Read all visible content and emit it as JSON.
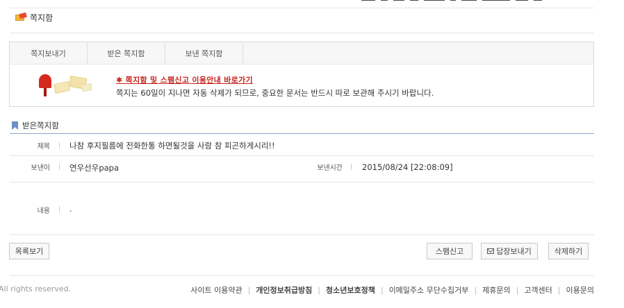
{
  "page": {
    "title": "쪽지함"
  },
  "tabs": [
    {
      "label": "쪽지보내기"
    },
    {
      "label": "받은 쪽지함"
    },
    {
      "label": "보낸 쪽지함"
    }
  ],
  "notice": {
    "link": "✱ 쪽지함 및 스팸신고 이용안내 바로가기",
    "text": "쪽지는 60일이 지나면 자동 삭제가 되므로, 중요한 문서는 반드시 따로 보관해 주시기 바랍니다."
  },
  "section": {
    "title": "받은쪽지함"
  },
  "message": {
    "subject_label": "제목",
    "subject": "나참 후지필름에 전화한통 하면될것을 사람 참 피곤하게시리!!",
    "sender_label": "보낸이",
    "sender": "연우선우papa",
    "sent_time_label": "보낸시간",
    "sent_time": "2015/08/24 [22:08:09]",
    "content_label": "내용",
    "content": "."
  },
  "buttons": {
    "list": "목록보기",
    "spam": "스팸신고",
    "reply": "답장보내기",
    "delete": "삭제하기"
  },
  "footer": {
    "copyright": "All rights reserved.",
    "links": [
      {
        "label": "사이트 이용약관",
        "bold": false
      },
      {
        "label": "개인정보취급방침",
        "bold": true
      },
      {
        "label": "청소년보호정책",
        "bold": true
      },
      {
        "label": "이메일주소 무단수집거부",
        "bold": false
      },
      {
        "label": "제휴문의",
        "bold": false
      },
      {
        "label": "고객센터",
        "bold": false
      },
      {
        "label": "이용문의",
        "bold": false
      }
    ]
  }
}
